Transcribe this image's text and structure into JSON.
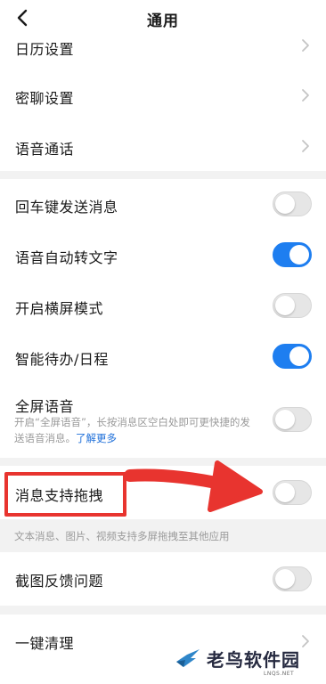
{
  "header": {
    "title": "通用"
  },
  "group1": [
    {
      "label": "日历设置"
    },
    {
      "label": "密聊设置"
    },
    {
      "label": "语音通话"
    }
  ],
  "group2": {
    "enter_send": {
      "label": "回车键发送消息",
      "enabled": false
    },
    "voice_to_text": {
      "label": "语音自动转文字",
      "enabled": true
    },
    "landscape": {
      "label": "开启横屏模式",
      "enabled": false
    },
    "smart_todo": {
      "label": "智能待办/日程",
      "enabled": true
    },
    "fullscreen_voice": {
      "label": "全屏语音",
      "desc": "开启“全屏语音”，长按消息区空白处即可更快捷的发送语音消息。",
      "link": "了解更多",
      "enabled": false
    }
  },
  "group3": {
    "drag": {
      "label": "消息支持拖拽",
      "enabled": false
    },
    "drag_note": "文本消息、图片、视频支持多屏拖拽至其他应用"
  },
  "group4": {
    "screenshot_feedback": {
      "label": "截图反馈问题",
      "enabled": false
    }
  },
  "group5": {
    "one_click_clean": {
      "label": "一键清理"
    }
  },
  "watermark": {
    "name": "老鸟软件园",
    "url": "LNQS.NET"
  },
  "colors": {
    "accent": "#1e7ef0",
    "annotation": "#e8342f",
    "link": "#1e6fd9"
  }
}
